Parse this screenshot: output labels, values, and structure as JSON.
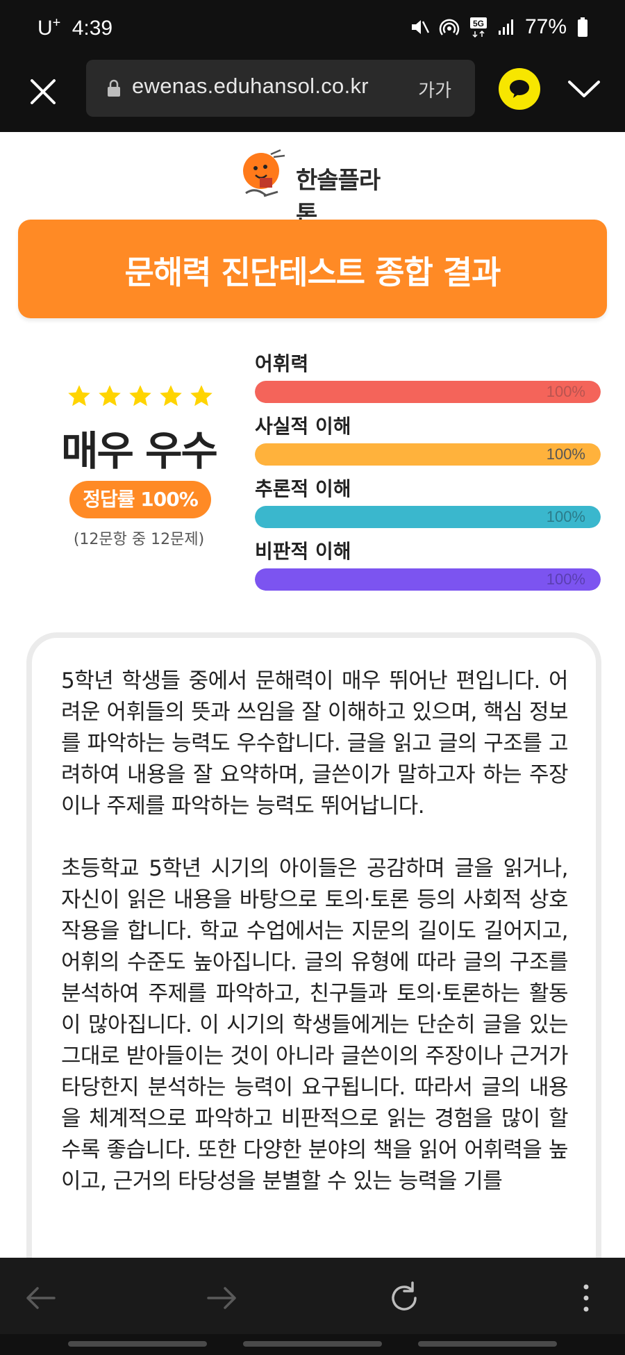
{
  "status_bar": {
    "carrier": "U",
    "carrier_sup": "+",
    "time": "4:39",
    "battery": "77%"
  },
  "browser": {
    "url": "ewenas.eduhansol.co.kr",
    "font_size_label": "가가"
  },
  "page": {
    "logo_text": "한솔플라톤",
    "title": "문해력 진단테스트 종합 결과",
    "summary": {
      "stars": 5,
      "grade": "매우 우수",
      "rate_label": "정답률 100%",
      "count_text": "(12문항 중 12문제)"
    },
    "skills": [
      {
        "label": "어휘력",
        "value": 100,
        "value_label": "100%",
        "color": "#f4645a",
        "text_color": "#b85450"
      },
      {
        "label": "사실적 이해",
        "value": 100,
        "value_label": "100%",
        "color": "#ffb23c",
        "text_color": "#555555"
      },
      {
        "label": "추론적 이해",
        "value": 100,
        "value_label": "100%",
        "color": "#3ab7cd",
        "text_color": "#2b7b8a"
      },
      {
        "label": "비판적 이해",
        "value": 100,
        "value_label": "100%",
        "color": "#7c54f0",
        "text_color": "#5a3fb0"
      }
    ],
    "description": [
      "5학년 학생들 중에서 문해력이 매우 뛰어난 편입니다. 어려운 어휘들의 뜻과 쓰임을 잘 이해하고 있으며, 핵심 정보를 파악하는 능력도 우수합니다. 글을 읽고 글의 구조를 고려하여 내용을 잘 요약하며, 글쓴이가 말하고자 하는 주장이나 주제를 파악하는 능력도 뛰어납니다.",
      "초등학교 5학년 시기의 아이들은 공감하며 글을 읽거나, 자신이 읽은 내용을 바탕으로 토의·토론 등의 사회적 상호작용을 합니다. 학교 수업에서는 지문의 길이도 길어지고, 어휘의 수준도 높아집니다. 글의 유형에 따라 글의 구조를 분석하여 주제를 파악하고, 친구들과 토의·토론하는 활동이 많아집니다. 이 시기의 학생들에게는 단순히 글을 있는 그대로 받아들이는 것이 아니라 글쓴이의 주장이나 근거가 타당한지 분석하는 능력이 요구됩니다. 따라서 글의 내용을 체계적으로 파악하고 비판적으로 읽는 경험을 많이 할수록 좋습니다. 또한 다양한 분야의 책을 읽어 어휘력을 높이고, 근거의 타당성을 분별할 수 있는 능력을 기를"
    ]
  },
  "colors": {
    "accent": "#ff8a25",
    "star": "#ffd400"
  }
}
